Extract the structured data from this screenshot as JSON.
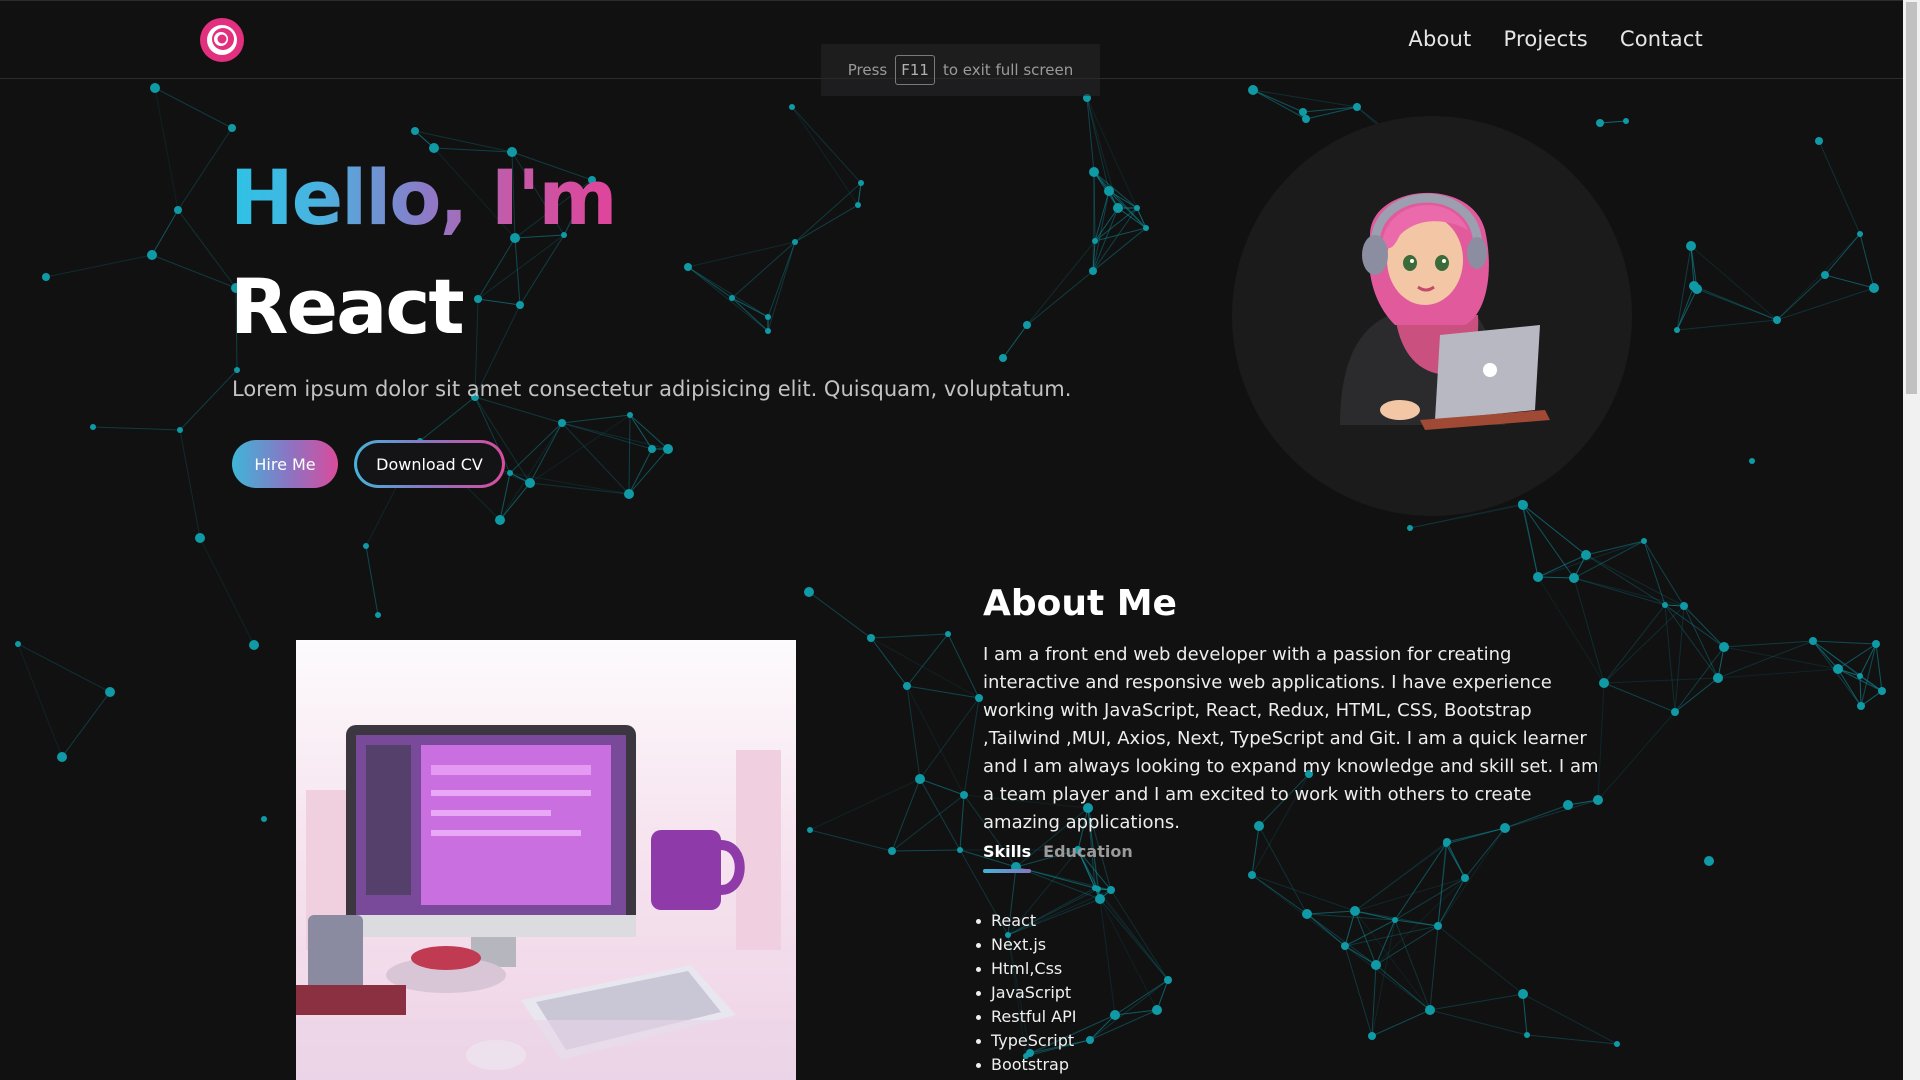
{
  "navbar": {
    "logo_name": "spiral-logo",
    "links": [
      "About",
      "Projects",
      "Contact"
    ]
  },
  "fullscreen_tip": {
    "before": "Press",
    "key": "F11",
    "after": "to exit full screen"
  },
  "hero": {
    "greeting": "Hello, I'm",
    "name": "React",
    "subtitle": "Lorem ipsum dolor sit amet consectetur adipisicing elit. Quisquam, voluptatum.",
    "hire_button": "Hire Me",
    "cv_button": "Download CV"
  },
  "about": {
    "title": "About Me",
    "body": "I am a front end web developer with a passion for creating interactive and responsive web applications. I have experience working with JavaScript, React, Redux, HTML, CSS, Bootstrap ,Tailwind ,MUI, Axios, Next, TypeScript and Git. I am a quick learner and I am always looking to expand my knowledge and skill set. I am a team player and I am excited to work with others to create amazing applications.",
    "tabs": [
      "Skills",
      "Education"
    ],
    "active_tab": "Skills",
    "skills": [
      "React",
      "Next.js",
      "Html,Css",
      "JavaScript",
      "Restful API",
      "TypeScript",
      "Bootstrap"
    ]
  },
  "colors": {
    "background": "#111112",
    "accent_cyan": "#2ec2e6",
    "accent_pink": "#e0449a",
    "network_line": "#0f8e99"
  }
}
